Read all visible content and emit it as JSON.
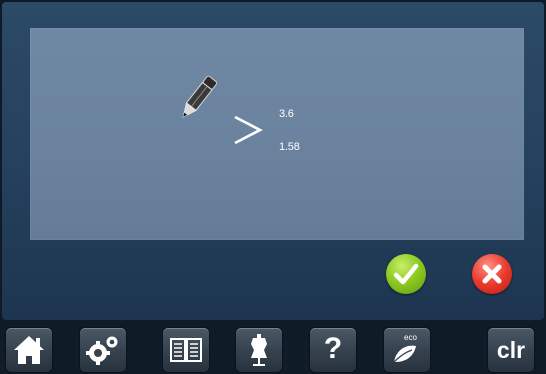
{
  "display": {
    "value_top": "3.6",
    "value_bottom": "1.58",
    "edit_icon": "pencil-icon",
    "arrow_icon": "greater-than-icon"
  },
  "actions": {
    "confirm_icon": "checkmark-icon",
    "cancel_icon": "close-icon",
    "confirm_color": "#8fcb22",
    "cancel_color": "#ea3b2d"
  },
  "toolbar": {
    "items": [
      {
        "icon": "home-icon"
      },
      {
        "icon": "settings-gears-icon"
      },
      {
        "icon": "book-icon"
      },
      {
        "icon": "dress-form-icon"
      },
      {
        "icon": "help-icon",
        "label": "?"
      },
      {
        "icon": "eco-leaf-icon",
        "label": "eco"
      },
      {
        "icon": "clear-icon",
        "label": "clr"
      }
    ]
  },
  "colors": {
    "background": "#0e1a26",
    "frame": "#2b4a68",
    "panel": "#6f88a4"
  }
}
